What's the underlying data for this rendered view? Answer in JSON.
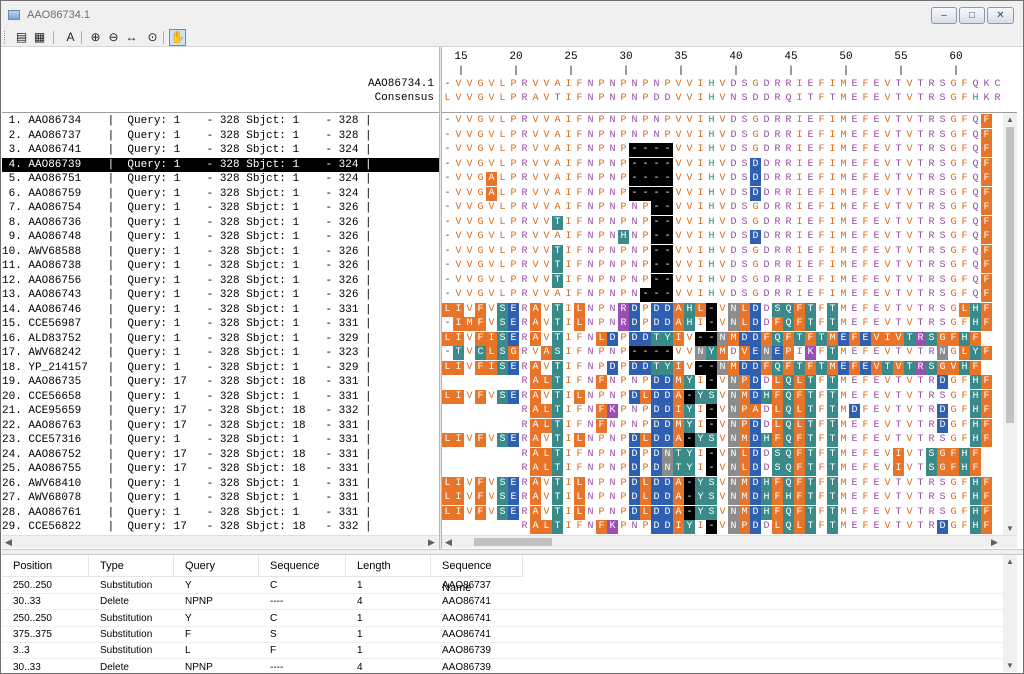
{
  "window": {
    "title": "AAO86734.1"
  },
  "toolbar": {
    "buttons": [
      {
        "name": "list-view-icon",
        "glyph": "▤"
      },
      {
        "name": "grid-view-icon",
        "glyph": "▦"
      },
      {
        "name": "font-icon",
        "glyph": "A"
      },
      {
        "name": "zoom-in-icon",
        "glyph": "⊕"
      },
      {
        "name": "zoom-out-icon",
        "glyph": "⊖"
      },
      {
        "name": "fit-width-icon",
        "glyph": "↔"
      },
      {
        "name": "zoom-custom-icon",
        "glyph": "⊙"
      },
      {
        "name": "hand-tool-icon",
        "glyph": "✋"
      }
    ]
  },
  "ruler": {
    "start": 15,
    "step": 5,
    "count": 10
  },
  "header": {
    "reference_label": "AAO86734.1",
    "consensus_label": "Consensus",
    "reference_seq": "-VVGVLPRVVAIFNPNPNPNPVVIHVDSGDRRIEFIMEFEVTVTRSGFQKC",
    "consensus_seq": "LVVGVLPRAVTIFNPNPNPDDVVIHVNSDDRQITFTMEFEVTVTRSGFHKR"
  },
  "rows": [
    {
      "label": " 1. AAO86734    |  Query: 1    - 328 Sbjct: 1    - 328 |",
      "seq": "-VVGVLPRVVAIFNPNPNPNPVVIHVDSGDRRIEFIMEFEVTVTRSGFQF"
    },
    {
      "label": " 2. AAO86737    |  Query: 1    - 328 Sbjct: 1    - 328 |",
      "seq": "-VVGVLPRVVAIFNPNPNPNPVVIHVDSGDRRIEFIMEFEVTVTRSGFQF"
    },
    {
      "label": " 3. AAO86741    |  Query: 1    - 328 Sbjct: 1    - 324 |",
      "seq": "-VVGVLPRVVAIFNPNP----VVIHVDSGDRRIEFIMEFEVTVTRSGFQF"
    },
    {
      "label": " 4. AAO86739    |  Query: 1    - 328 Sbjct: 1    - 324 |",
      "seq": "-VVGVLPRVVAIFNPNP----VVIHVDSDDRRIEFIMEFEVTVTRSGFQF"
    },
    {
      "label": " 5. AAO86751    |  Query: 1    - 328 Sbjct: 1    - 324 |",
      "seq": "-VVGALPRVVAIFNPNP----VVIHVDSDDRRIEFIMEFEVTVTRSGFQF"
    },
    {
      "label": " 6. AAO86759    |  Query: 1    - 328 Sbjct: 1    - 324 |",
      "seq": "-VVGALPRVVAIFNPNP----VVIHVDSDDRRIEFIMEFEVTVTRSGFQF"
    },
    {
      "label": " 7. AAO86754    |  Query: 1    - 328 Sbjct: 1    - 326 |",
      "seq": "-VVGVLPRVVAIFNPNPNP--VVIHVDSGDRRIEFIMEFEVTVTRSGFQF"
    },
    {
      "label": " 8. AAO86736    |  Query: 1    - 328 Sbjct: 1    - 326 |",
      "seq": "-VVGVLPRVVTIFNPNPNP--VVIHVDSGDRRIEFIMEFEVTVTRSGFQF"
    },
    {
      "label": " 9. AAO86748    |  Query: 1    - 328 Sbjct: 1    - 326 |",
      "seq": "-VVGVLPRVVAIFNPNHNP--VVIHVDSDDRRIEFIMEFEVTVTRSGFQF"
    },
    {
      "label": "10. AWV68588    |  Query: 1    - 328 Sbjct: 1    - 326 |",
      "seq": "-VVGVLPRVVTIFNPNPNP--VVIHVDSGDRRIEFIMEFEVTVTRSGFQF"
    },
    {
      "label": "11. AAO86738    |  Query: 1    - 328 Sbjct: 1    - 326 |",
      "seq": "-VVGVLPRVVTIFNPNPNP--VVIHVDSGDRRIEFIMEFEVTVTRSGFQF"
    },
    {
      "label": "12. AAO86756    |  Query: 1    - 328 Sbjct: 1    - 326 |",
      "seq": "-VVGVLPRVVTIFNPNPNP--VVIHVDSGDRRIEFIMEFEVTVTRSGFQF"
    },
    {
      "label": "13. AAO86743    |  Query: 1    - 328 Sbjct: 1    - 326 |",
      "seq": "-VVGVLPRVVAIFNPNPN---VVIHVDSGDRRIEFIMEFEVTVTRSGFQF"
    },
    {
      "label": "14. AAO86746    |  Query: 1    - 328 Sbjct: 1    - 331 |",
      "seq": "LIVFVSERAVTILNPNRDPDDAHL-VNLDDSQFTFTMEFEVTVTRSGLHF"
    },
    {
      "label": "15. CCE56987    |  Query: 1    - 328 Sbjct: 1    - 331 |",
      "seq": "-IMFVSERAVTILNPNRDPDDAHI-VNLDDFQFTFTMEFEVTVTRSGFHF"
    },
    {
      "label": "16. ALD83752    |  Query: 1    - 328 Sbjct: 1    - 329 |",
      "seq": "LIVFISERAVTIFNLDPDDTYIV--NMDDFQFTFTMEFEVIVTRSGFHF"
    },
    {
      "label": "17. AWV68242    |  Query: 1    - 328 Sbjct: 1    - 323 |",
      "seq": "-TVCLSGRVASIFNPNP----VVNYMDVENEPIKFTMEFEVTVTRNGLYF"
    },
    {
      "label": "18. YP_214157   |  Query: 1    - 328 Sbjct: 1    - 329 |",
      "seq": "LIVFISERAVTIFNPDPDDTYIV--NMDDFQFTFTMEFEVTVTRSGVHF"
    },
    {
      "label": "19. AAO86735    |  Query: 17   - 328 Sbjct: 18   - 331 |",
      "seq": "       RALTIFNFNPNPDDMYI-VNPDDLQLTFTMEFEVTVTRDGFHF"
    },
    {
      "label": "20. CCE56658    |  Query: 1    - 328 Sbjct: 1    - 331 |",
      "seq": "LIVFVSERAVTILNPNPDLDDA-YSVNMDHFQFTFTMEFEVTVTRSGFHF"
    },
    {
      "label": "21. ACE95659    |  Query: 17   - 328 Sbjct: 18   - 332 |",
      "seq": "       RALTIFNFKPNPDDIYI-VNPADLQLTFTMDFEVTVTRDGFHF"
    },
    {
      "label": "22. AAO86763    |  Query: 17   - 328 Sbjct: 18   - 331 |",
      "seq": "       RALTIFNFNPNPDDMYI-VNPDDLQLTFTMEFEVTVTRDGFHF"
    },
    {
      "label": "23. CCE57316    |  Query: 1    - 328 Sbjct: 1    - 331 |",
      "seq": "LIVFVSERAVTILNPNPDLDDA-YSVNMDHFQFTFTMEFEVTVTRSGFHF"
    },
    {
      "label": "24. AAO86752    |  Query: 17   - 328 Sbjct: 18   - 331 |",
      "seq": "       RALTIFNPNPDPDNTYI-VNLDDSQFTFTMEFEVIVTSGFHF"
    },
    {
      "label": "25. AAO86755    |  Query: 17   - 328 Sbjct: 18   - 331 |",
      "seq": "       RALTIFNPNPDPDNTYI-VNLDDSQFTFTMEFEVIVTSGFHF"
    },
    {
      "label": "26. AWV68410    |  Query: 1    - 328 Sbjct: 1    - 331 |",
      "seq": "LIVFVSERAVTILNPNPDLDDA-YSVNMDHFQFTFTMEFEVTVTRSGFHF"
    },
    {
      "label": "27. AWV68078    |  Query: 1    - 328 Sbjct: 1    - 331 |",
      "seq": "LIVFVSERAVTILNPNPDLDDA-YSVNMDHFHFTFTMEFEVTVTRSGFHF"
    },
    {
      "label": "28. AAO86761    |  Query: 1    - 328 Sbjct: 1    - 331 |",
      "seq": "LIVFVSERAVTILNPNPDLDDA-YSVNMDHFQFTFTMEFEVTVTRSGFHF"
    },
    {
      "label": "29. CCE56822    |  Query: 17   - 328 Sbjct: 18   - 332 |",
      "seq": "       RALTIFNFKPNPDDIYI-VNPDDLQLTFTMEFEVTVTRDGFHF"
    }
  ],
  "selected_row": 3,
  "colors": {
    "hydrophobic": "#e8742a",
    "polar_teal": "#3a8a8a",
    "acidic_blue": "#2f5fb0",
    "basic_purple": "#9b4fb0",
    "gap_black": "#000000",
    "grey": "#8c8c8c",
    "text_orange": "#d96a1a",
    "text_purple": "#9a4aa6",
    "text_teal": "#2f8a8a",
    "text_blue": "#3060b0"
  },
  "table": {
    "columns": [
      "Position",
      "Type",
      "Query",
      "Sequence",
      "Length",
      "Sequence Name"
    ],
    "rows": [
      [
        "250..250",
        "Substitution",
        "Y",
        "C",
        "1",
        "AAO86737"
      ],
      [
        "30..33",
        "Delete",
        "NPNP",
        "----",
        "4",
        "AAO86741"
      ],
      [
        "250..250",
        "Substitution",
        "Y",
        "C",
        "1",
        "AAO86741"
      ],
      [
        "375..375",
        "Substitution",
        "F",
        "S",
        "1",
        "AAO86741"
      ],
      [
        "3..3",
        "Substitution",
        "L",
        "F",
        "1",
        "AAO86739"
      ],
      [
        "30..33",
        "Delete",
        "NPNP",
        "----",
        "4",
        "AAO86739"
      ]
    ]
  }
}
